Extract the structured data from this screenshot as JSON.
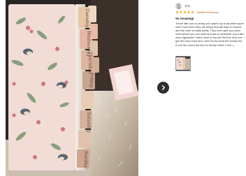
{
  "photo": {
    "tab_labels": [
      "Tuesday",
      "Wednesday",
      "Thursday",
      "Friday",
      "Saturday",
      "Sunday"
    ],
    "next_icon": "chevron-right-icon"
  },
  "review": {
    "username": "Tina",
    "rating": 5,
    "max_rating": 5,
    "verified_label": "Verified Purchase",
    "title": "So Amazing!",
    "body": "These tabs are so pretty and match my study bible super well! I love them they are sticky and will stay on forever and the color is really pretty. They even give you extra ones where you can write and put on wherever you'd like, very organized! I didn't have to try and find the next one. I got the color boho and I don't know what the means but to me the colors are kind of earthy which I love :)",
    "star_color": "#f5a623",
    "verified_color": "#c45500"
  }
}
